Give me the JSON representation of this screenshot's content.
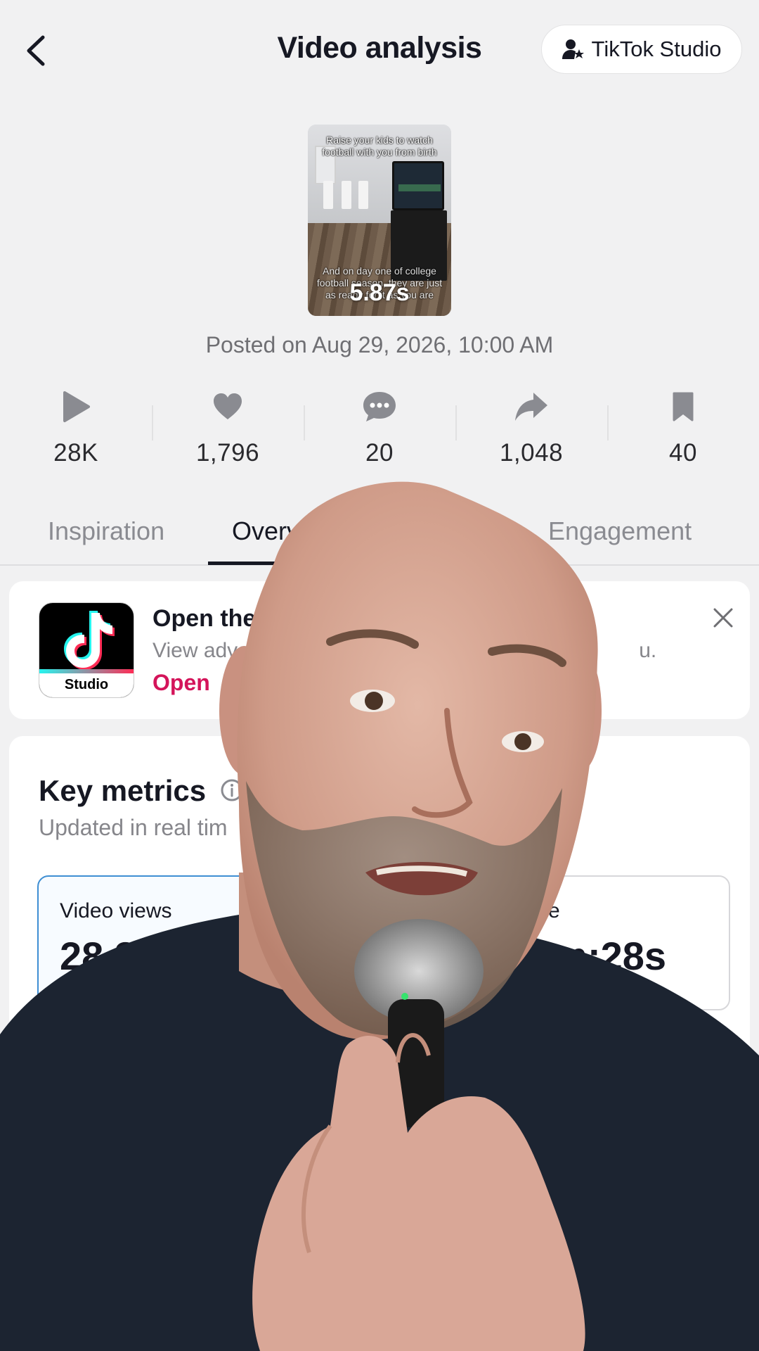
{
  "header": {
    "title": "Video analysis",
    "studio_button": "TikTok Studio"
  },
  "video": {
    "caption_top": "Raise your kids to watch football with you from birth",
    "caption_bottom": "And on day one of college football season, they are just as ready for it as you are",
    "duration": "5.87s",
    "posted": "Posted on Aug 29, 2026, 10:00 AM"
  },
  "stats": [
    {
      "icon": "play-icon",
      "value": "28K"
    },
    {
      "icon": "heart-icon",
      "value": "1,796"
    },
    {
      "icon": "comment-icon",
      "value": "20"
    },
    {
      "icon": "share-icon",
      "value": "1,048"
    },
    {
      "icon": "bookmark-icon",
      "value": "40"
    }
  ],
  "tabs": {
    "inspiration": "Inspiration",
    "overview": "Overview",
    "engagement": "Engagement"
  },
  "banner": {
    "title": "Open the Ti",
    "description_left": "View advanc",
    "description_right": "u.",
    "open_label": "Open",
    "logo_label": "Studio"
  },
  "metrics": {
    "title": "Key metrics",
    "subtitle": "Updated in real tim",
    "cards": [
      {
        "label": "Video views",
        "value": "28.3K"
      },
      {
        "label": "me",
        "value": "4m:28s"
      }
    ]
  },
  "colors": {
    "accent": "#d4145a",
    "selected_border": "#3f8fd3",
    "background": "#f1f1f2"
  }
}
